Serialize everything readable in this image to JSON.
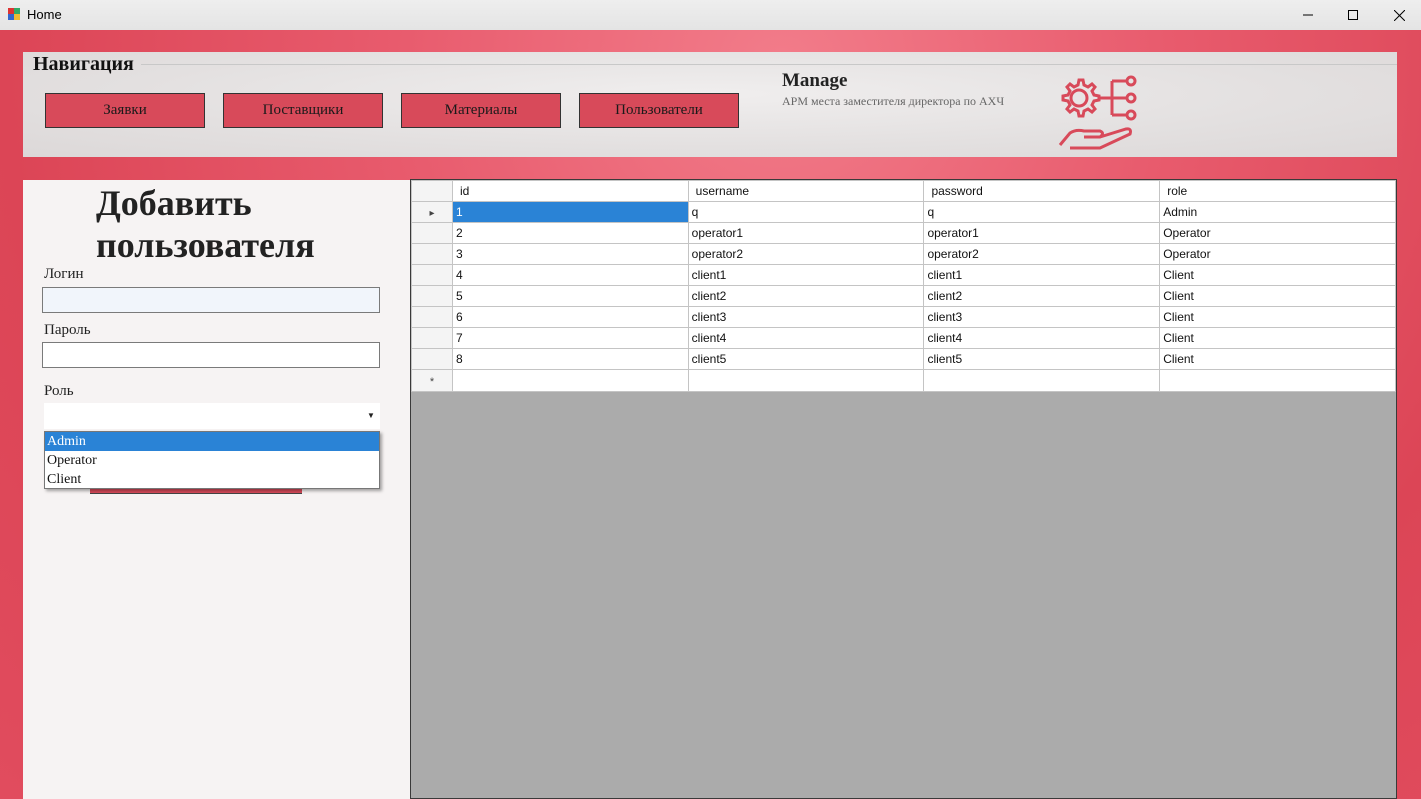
{
  "window": {
    "title": "Home",
    "icon": "app-icon",
    "controls": [
      "minimize-icon",
      "maximize-icon",
      "close-icon"
    ]
  },
  "navigation": {
    "title": "Навигация",
    "buttons": [
      "Заявки",
      "Поставщики",
      "Материалы",
      "Пользователи"
    ]
  },
  "brand": {
    "title": "Manage",
    "subtitle": "АРМ места заместителя директора по АХЧ",
    "icon": "gear-network-hand-icon",
    "accent": "#d84a5a"
  },
  "form": {
    "title": "Добавить пользователя",
    "login_label": "Логин",
    "login_value": "",
    "password_label": "Пароль",
    "password_value": "",
    "role_label": "Роль",
    "role_value": "",
    "role_options": [
      "Admin",
      "Operator",
      "Client"
    ],
    "role_selected": "Admin"
  },
  "grid": {
    "columns": [
      "id",
      "username",
      "password",
      "role"
    ],
    "rows": [
      [
        "1",
        "q",
        "q",
        "Admin"
      ],
      [
        "2",
        "operator1",
        "operator1",
        "Operator"
      ],
      [
        "3",
        "operator2",
        "operator2",
        "Operator"
      ],
      [
        "4",
        "client1",
        "client1",
        "Client"
      ],
      [
        "5",
        "client2",
        "client2",
        "Client"
      ],
      [
        "6",
        "client3",
        "client3",
        "Client"
      ],
      [
        "7",
        "client4",
        "client4",
        "Client"
      ],
      [
        "8",
        "client5",
        "client5",
        "Client"
      ]
    ],
    "current_row_marker": "▸",
    "new_row_marker": "*",
    "selection_color": "#2a83d6"
  }
}
